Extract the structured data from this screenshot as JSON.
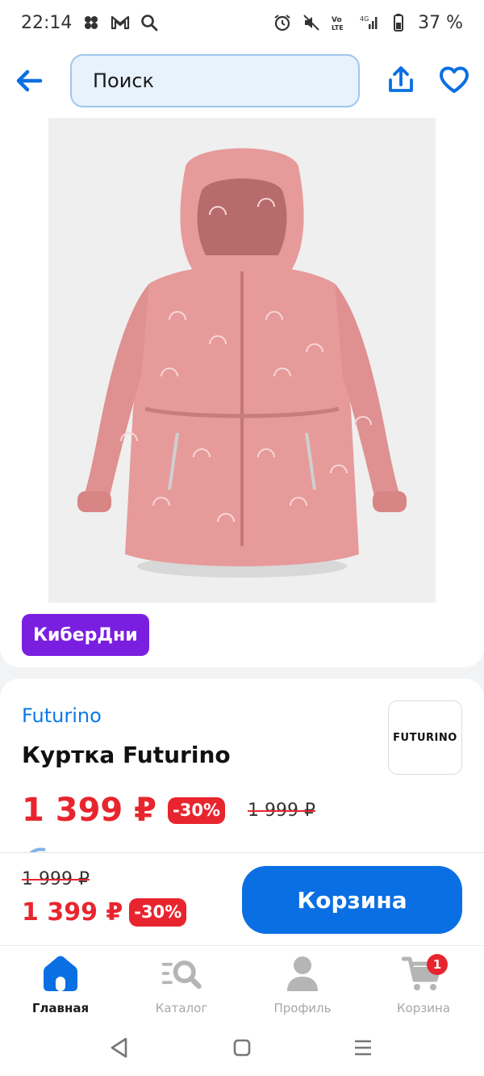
{
  "status_bar": {
    "time": "22:14",
    "battery": "37 %",
    "left_icons": [
      "apps-dots-icon",
      "gmail-icon",
      "search-icon"
    ],
    "right_icons": [
      "alarm-icon",
      "mute-icon",
      "volte-icon",
      "signal-icon",
      "battery-icon"
    ]
  },
  "header": {
    "search_placeholder": "Поиск",
    "back_icon": "arrow-left-icon",
    "share_icon": "share-icon",
    "favorite_icon": "heart-icon"
  },
  "product": {
    "promo_badge": "КиберДни",
    "brand": "Futurino",
    "brand_logo_text": "FUTURINO",
    "title": "Куртка Futurino",
    "price": "1 399 ₽",
    "discount": "-30%",
    "old_price": "1 999 ₽"
  },
  "buy_bar": {
    "old_price": "1 999 ₽",
    "price": "1 399 ₽",
    "discount": "-30%",
    "cart_button": "Корзина"
  },
  "tabs": [
    {
      "label": "Главная",
      "icon": "home-icon",
      "active": true
    },
    {
      "label": "Каталог",
      "icon": "catalog-search-icon",
      "active": false
    },
    {
      "label": "Профиль",
      "icon": "profile-icon",
      "active": false
    },
    {
      "label": "Корзина",
      "icon": "cart-icon",
      "active": false,
      "badge": "1"
    }
  ],
  "colors": {
    "accent": "#0a6fe3",
    "price_red": "#e8252e",
    "promo_purple": "#7a1fe0",
    "jacket_pink": "#e79a9a"
  }
}
